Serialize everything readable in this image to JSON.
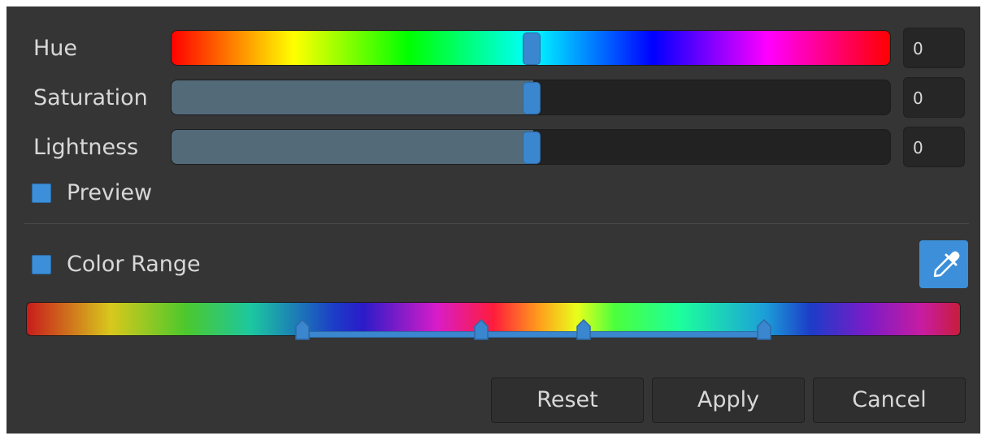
{
  "sliders": [
    {
      "label": "Hue",
      "value": "0",
      "level": 0.5
    },
    {
      "label": "Saturation",
      "value": "0",
      "level": 0.5
    },
    {
      "label": "Lightness",
      "value": "0",
      "level": 0.5
    }
  ],
  "preview": {
    "label": "Preview",
    "checked": true
  },
  "color_range": {
    "label": "Color Range",
    "checked": true,
    "eyedropper_icon": "eyedropper-icon"
  },
  "buttons": {
    "reset": "Reset",
    "apply": "Apply",
    "cancel": "Cancel"
  },
  "colors": {
    "accent": "#3c8fd8",
    "panel": "#353535",
    "track_fill": "#536a79"
  }
}
